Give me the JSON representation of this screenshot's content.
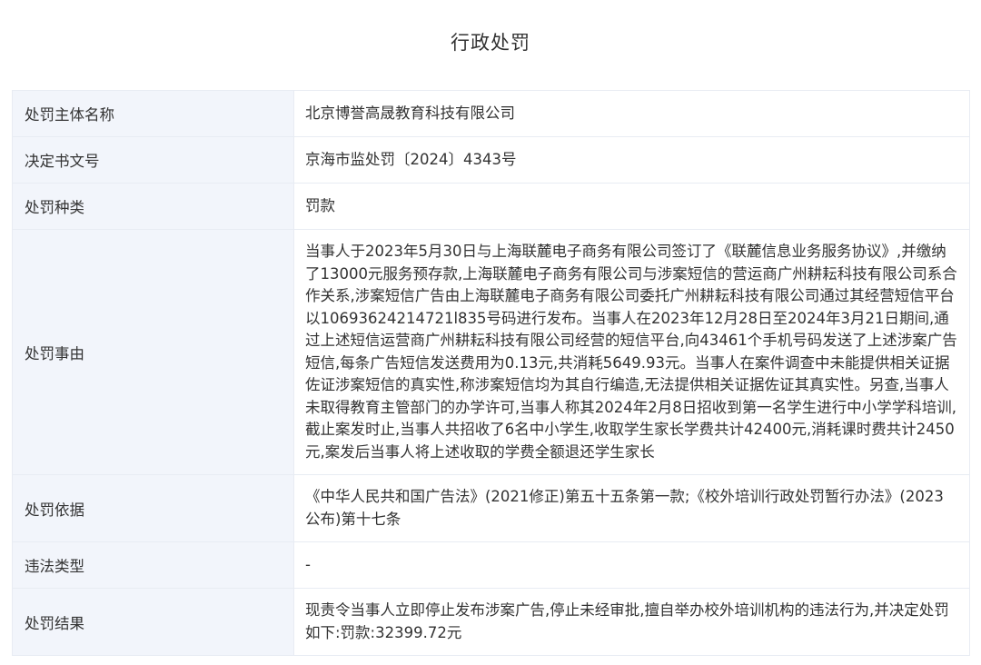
{
  "page": {
    "title": "行政处罚"
  },
  "rows": [
    {
      "label": "处罚主体名称",
      "value": "北京博誉高晟教育科技有限公司"
    },
    {
      "label": "决定书文号",
      "value": "京海市监处罚〔2024〕4343号"
    },
    {
      "label": "处罚种类",
      "value": "罚款"
    },
    {
      "label": "处罚事由",
      "value": "当事人于2023年5月30日与上海联麓电子商务有限公司签订了《联麓信息业务服务协议》,并缴纳了13000元服务预存款,上海联麓电子商务有限公司与涉案短信的营运商广州耕耘科技有限公司系合作关系,涉案短信广告由上海联麓电子商务有限公司委托广州耕耘科技有限公司通过其经营短信平台以10693624214721l835号码进行发布。当事人在2023年12月28日至2024年3月21日期间,通过上述短信运营商广州耕耘科技有限公司经营的短信平台,向43461个手机号码发送了上述涉案广告短信,每条广告短信发送费用为0.13元,共消耗5649.93元。当事人在案件调查中未能提供相关证据佐证涉案短信的真实性,称涉案短信均为其自行编造,无法提供相关证据佐证其真实性。另查,当事人未取得教育主管部门的办学许可,当事人称其2024年2月8日招收到第一名学生进行中小学学科培训,截止案发时止,当事人共招收了6名中小学生,收取学生家长学费共计42400元,消耗课时费共计2450元,案发后当事人将上述收取的学费全额退还学生家长"
    },
    {
      "label": "处罚依据",
      "value": "《中华人民共和国广告法》(2021修正)第五十五条第一款;《校外培训行政处罚暂行办法》(2023公布)第十七条"
    },
    {
      "label": "违法类型",
      "value": "-"
    },
    {
      "label": "处罚结果",
      "value": "现责令当事人立即停止发布涉案广告,停止未经审批,擅自举办校外培训机构的违法行为,并决定处罚如下:罚款:32399.72元"
    }
  ]
}
